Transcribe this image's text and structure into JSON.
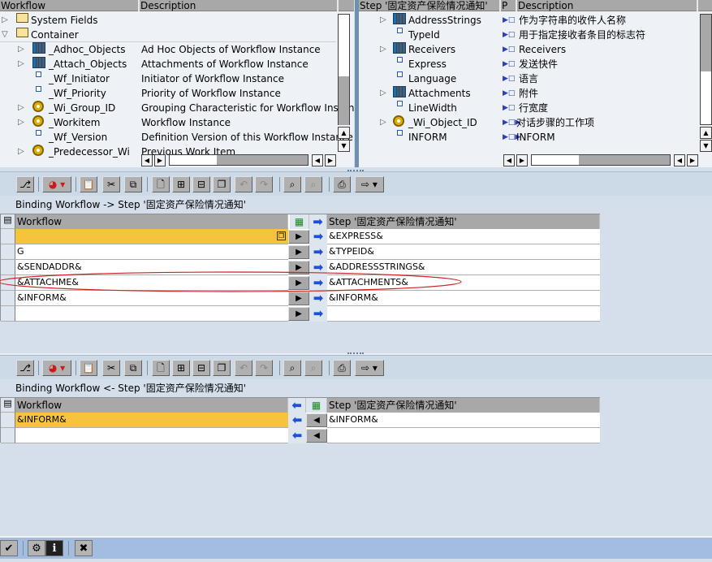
{
  "left_tree": {
    "columns": [
      "Workflow",
      "Description"
    ],
    "rows": [
      {
        "indent": 0,
        "expander": "collapsed",
        "icon": "folder-icon",
        "name": "System Fields",
        "desc": ""
      },
      {
        "indent": 0,
        "expander": "expanded",
        "icon": "folder-open-icon",
        "name": "Container",
        "desc": ""
      },
      {
        "indent": 1,
        "expander": "collapsed",
        "icon": "table-icon",
        "name": "_Adhoc_Objects",
        "desc": "Ad Hoc Objects of Workflow Instance"
      },
      {
        "indent": 1,
        "expander": "collapsed",
        "icon": "table-icon",
        "name": "_Attach_Objects",
        "desc": "Attachments of Workflow Instance"
      },
      {
        "indent": 1,
        "expander": "none",
        "icon": "field-icon",
        "name": "_Wf_Initiator",
        "desc": "Initiator of Workflow Instance"
      },
      {
        "indent": 1,
        "expander": "none",
        "icon": "field-icon",
        "name": "_Wf_Priority",
        "desc": "Priority of Workflow Instance"
      },
      {
        "indent": 1,
        "expander": "collapsed",
        "icon": "object-icon",
        "name": "_Wi_Group_ID",
        "desc": "Grouping Characteristic for Workflow Instanc"
      },
      {
        "indent": 1,
        "expander": "collapsed",
        "icon": "object-icon",
        "name": "_Workitem",
        "desc": "Workflow Instance"
      },
      {
        "indent": 1,
        "expander": "none",
        "icon": "field-icon",
        "name": "_Wf_Version",
        "desc": "Definition Version of this Workflow Instance"
      },
      {
        "indent": 1,
        "expander": "collapsed",
        "icon": "object-icon",
        "name": "_Predecessor_Wi",
        "desc": "Previous Work Item"
      }
    ]
  },
  "right_tree": {
    "columns": [
      "Step '固定资产保险情况通知'",
      "P",
      "Description"
    ],
    "rows": [
      {
        "expander": "collapsed",
        "icon": "table-icon",
        "name": "AddressStrings",
        "param": "import",
        "desc": "作为字符串的收件人名称"
      },
      {
        "expander": "none",
        "icon": "field-icon",
        "name": "TypeId",
        "param": "import",
        "desc": "用于指定接收者条目的标志符"
      },
      {
        "expander": "collapsed",
        "icon": "table-icon",
        "name": "Receivers",
        "param": "import",
        "desc": "Receivers"
      },
      {
        "expander": "none",
        "icon": "field-icon",
        "name": "Express",
        "param": "import",
        "desc": "发送快件"
      },
      {
        "expander": "none",
        "icon": "field-icon",
        "name": "Language",
        "param": "import",
        "desc": "语言"
      },
      {
        "expander": "collapsed",
        "icon": "table-icon",
        "name": "Attachments",
        "param": "import",
        "desc": "附件"
      },
      {
        "expander": "none",
        "icon": "field-icon",
        "name": "LineWidth",
        "param": "import",
        "desc": "行宽度"
      },
      {
        "expander": "collapsed",
        "icon": "object-icon",
        "name": "_Wi_Object_ID",
        "param": "import-export",
        "desc": "对话步骤的工作项"
      },
      {
        "expander": "none",
        "icon": "field-icon",
        "name": "INFORM",
        "param": "import-export",
        "desc": "INFORM"
      }
    ]
  },
  "toolbar_buttons": [
    {
      "name": "binding-check-button",
      "glyph": "⎇",
      "enabled": true
    },
    {
      "name": "delete-binding-button",
      "glyph": "◕",
      "enabled": true,
      "dropdown": true
    },
    {
      "name": "paste-button",
      "glyph": "📋",
      "enabled": true
    },
    {
      "name": "cut-button",
      "glyph": "✂",
      "enabled": true
    },
    {
      "name": "copy-button",
      "glyph": "⧉",
      "enabled": true
    },
    {
      "name": "new-button",
      "glyph": "🗋",
      "enabled": true
    },
    {
      "name": "insert-row-button",
      "glyph": "⊞",
      "enabled": true
    },
    {
      "name": "delete-row-button",
      "glyph": "⊟",
      "enabled": true
    },
    {
      "name": "duplicate-button",
      "glyph": "❐",
      "enabled": true
    },
    {
      "name": "undo-button",
      "glyph": "↶",
      "enabled": false
    },
    {
      "name": "redo-button",
      "glyph": "↷",
      "enabled": false
    },
    {
      "name": "find-button",
      "glyph": "⌕",
      "enabled": true
    },
    {
      "name": "find-next-button",
      "glyph": "⌕",
      "enabled": false
    },
    {
      "name": "print-button",
      "glyph": "⎙",
      "enabled": true
    },
    {
      "name": "export-button",
      "glyph": "⇨",
      "enabled": true,
      "dropdown": true
    }
  ],
  "binding_to_step": {
    "title": "Binding Workflow  -> Step '固定资产保险情况通知'",
    "left_header": "Workflow",
    "right_header": "Step '固定资产保险情况通知'",
    "rows": [
      {
        "workflow": "",
        "step": "&EXPRESS&",
        "selected": true
      },
      {
        "workflow": "G",
        "step": "&TYPEID&"
      },
      {
        "workflow": "&SENDADDR&",
        "step": "&ADDRESSSTRINGS&"
      },
      {
        "workflow": "&ATTACHME&",
        "step": "&ATTACHMENTS&",
        "highlighted": true
      },
      {
        "workflow": "&INFORM&",
        "step": "&INFORM&"
      },
      {
        "workflow": "",
        "step": ""
      }
    ]
  },
  "binding_from_step": {
    "title": "Binding Workflow  <- Step '固定资产保险情况通知'",
    "left_header": "Workflow",
    "right_header": "Step '固定资产保险情况通知'",
    "rows": [
      {
        "workflow": "&INFORM&",
        "step": "&INFORM&",
        "selected": true
      },
      {
        "workflow": "",
        "step": ""
      }
    ]
  },
  "footer_buttons": [
    {
      "name": "confirm-button",
      "glyph": "✔"
    },
    {
      "name": "generate-binding-button",
      "glyph": "⚙"
    },
    {
      "name": "info-button",
      "glyph": "i"
    },
    {
      "name": "cancel-button",
      "glyph": "✖"
    }
  ],
  "colors": {
    "selected_row": "#f6c43c",
    "header_gray": "#a8a8a8",
    "panel_bg": "#d4dfeb",
    "annotation_red": "#cc2222",
    "arrow_blue": "#1d4fd8"
  }
}
